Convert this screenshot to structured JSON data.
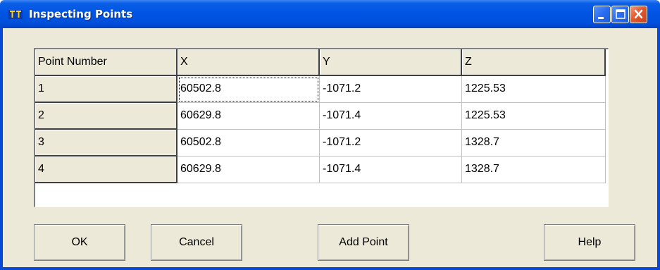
{
  "window": {
    "title": "Inspecting Points"
  },
  "grid": {
    "columns": [
      "Point Number",
      "X",
      "Y",
      "Z"
    ],
    "rows": [
      [
        "1",
        "60502.8",
        "-1071.2",
        "1225.53"
      ],
      [
        "2",
        "60629.8",
        "-1071.4",
        "1225.53"
      ],
      [
        "3",
        "60502.8",
        "-1071.2",
        "1328.7"
      ],
      [
        "4",
        "60629.8",
        "-1071.4",
        "1328.7"
      ]
    ]
  },
  "buttons": {
    "ok": "OK",
    "cancel": "Cancel",
    "add_point": "Add Point",
    "help": "Help"
  },
  "colors": {
    "title_bar": "#0054e3",
    "close_button": "#e3592f",
    "dialog_face": "#ece9d8"
  }
}
